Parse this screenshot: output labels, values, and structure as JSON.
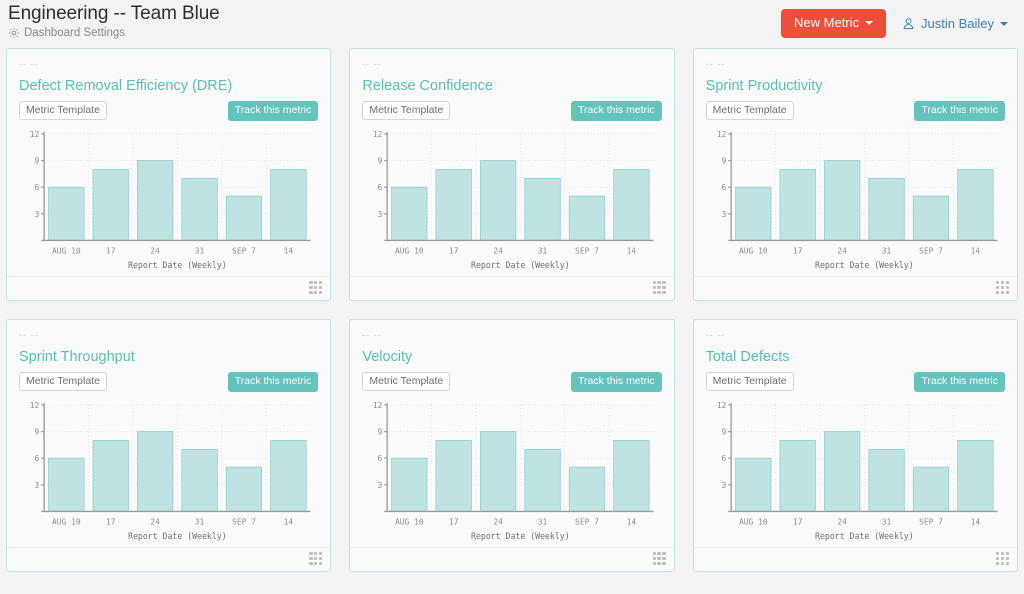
{
  "header": {
    "dashboard_title": "Engineering -- Team Blue",
    "settings_label": "Dashboard Settings",
    "settings_icon": "gear-icon",
    "new_metric_label": "New Metric",
    "new_metric_color": "#ef4e3a",
    "user_name": "Justin Bailey",
    "user_icon": "person-icon"
  },
  "theme": {
    "accent_teal": "#64c4bd",
    "title_teal": "#57bfb8",
    "card_border": "#bfe3e2",
    "page_bg": "#f3f3f3",
    "bar_fill": "#bfe3e0",
    "bar_stroke": "#8fd0cb"
  },
  "cards": [
    {
      "placeholder": "-- --",
      "title": "Defect Removal Efficiency (DRE)",
      "badge": "Metric Template",
      "track_label": "Track this metric"
    },
    {
      "placeholder": "-- --",
      "title": "Release Confidence",
      "badge": "Metric Template",
      "track_label": "Track this metric"
    },
    {
      "placeholder": "-- --",
      "title": "Sprint Productivity",
      "badge": "Metric Template",
      "track_label": "Track this metric"
    },
    {
      "placeholder": "-- --",
      "title": "Sprint Throughput",
      "badge": "Metric Template",
      "track_label": "Track this metric"
    },
    {
      "placeholder": "-- --",
      "title": "Velocity",
      "badge": "Metric Template",
      "track_label": "Track this metric"
    },
    {
      "placeholder": "-- --",
      "title": "Total Defects",
      "badge": "Metric Template",
      "track_label": "Track this metric"
    }
  ],
  "chart_data": [
    {
      "type": "bar",
      "title": "Defect Removal Efficiency (DRE)",
      "categories": [
        "AUG 10",
        "17",
        "24",
        "31",
        "SEP 7",
        "14"
      ],
      "values": [
        6,
        8,
        9,
        7,
        5,
        8
      ],
      "xlabel": "Report Date (Weekly)",
      "ylabel": "",
      "ylim": [
        0,
        12
      ],
      "yticks": [
        3,
        6,
        9,
        12
      ],
      "grid": true,
      "legend": "none"
    },
    {
      "type": "bar",
      "title": "Release Confidence",
      "categories": [
        "AUG 10",
        "17",
        "24",
        "31",
        "SEP 7",
        "14"
      ],
      "values": [
        6,
        8,
        9,
        7,
        5,
        8
      ],
      "xlabel": "Report Date (Weekly)",
      "ylabel": "",
      "ylim": [
        0,
        12
      ],
      "yticks": [
        3,
        6,
        9,
        12
      ],
      "grid": true,
      "legend": "none"
    },
    {
      "type": "bar",
      "title": "Sprint Productivity",
      "categories": [
        "AUG 10",
        "17",
        "24",
        "31",
        "SEP 7",
        "14"
      ],
      "values": [
        6,
        8,
        9,
        7,
        5,
        8
      ],
      "xlabel": "Report Date (Weekly)",
      "ylabel": "",
      "ylim": [
        0,
        12
      ],
      "yticks": [
        3,
        6,
        9,
        12
      ],
      "grid": true,
      "legend": "none"
    },
    {
      "type": "bar",
      "title": "Sprint Throughput",
      "categories": [
        "AUG 10",
        "17",
        "24",
        "31",
        "SEP 7",
        "14"
      ],
      "values": [
        6,
        8,
        9,
        7,
        5,
        8
      ],
      "xlabel": "Report Date (Weekly)",
      "ylabel": "",
      "ylim": [
        0,
        12
      ],
      "yticks": [
        3,
        6,
        9,
        12
      ],
      "grid": true,
      "legend": "none"
    },
    {
      "type": "bar",
      "title": "Velocity",
      "categories": [
        "AUG 10",
        "17",
        "24",
        "31",
        "SEP 7",
        "14"
      ],
      "values": [
        6,
        8,
        9,
        7,
        5,
        8
      ],
      "xlabel": "Report Date (Weekly)",
      "ylabel": "",
      "ylim": [
        0,
        12
      ],
      "yticks": [
        3,
        6,
        9,
        12
      ],
      "grid": true,
      "legend": "none"
    },
    {
      "type": "bar",
      "title": "Total Defects",
      "categories": [
        "AUG 10",
        "17",
        "24",
        "31",
        "SEP 7",
        "14"
      ],
      "values": [
        6,
        8,
        9,
        7,
        5,
        8
      ],
      "xlabel": "Report Date (Weekly)",
      "ylabel": "",
      "ylim": [
        0,
        12
      ],
      "yticks": [
        3,
        6,
        9,
        12
      ],
      "grid": true,
      "legend": "none"
    }
  ]
}
